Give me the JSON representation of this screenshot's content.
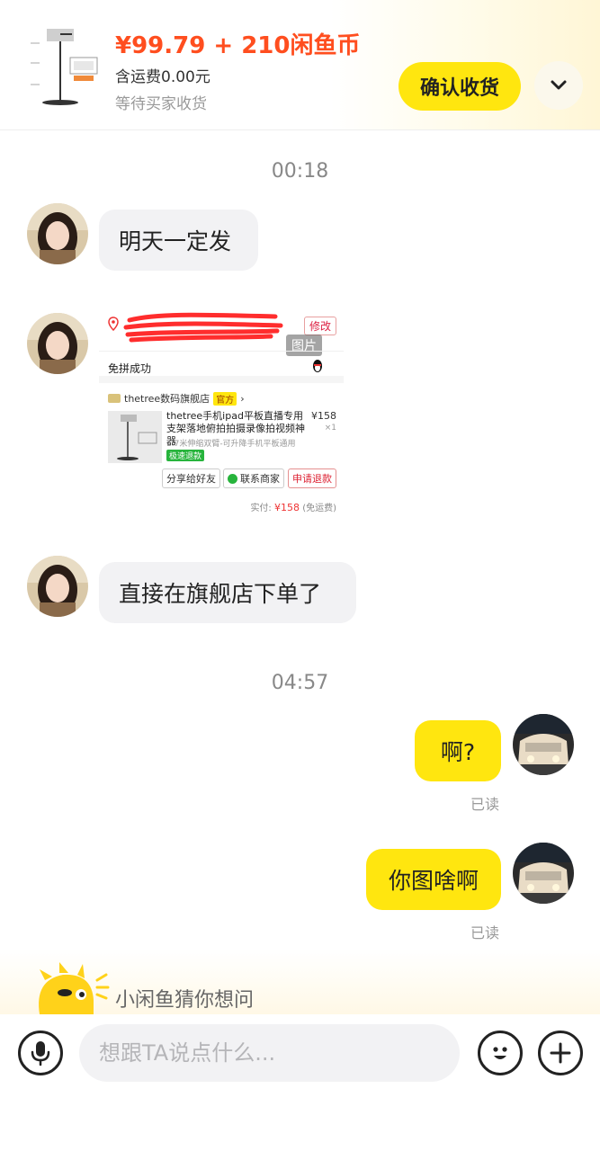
{
  "order": {
    "price": "¥99.79 + 210闲鱼币",
    "shipping": "含运费0.00元",
    "status": "等待买家收货",
    "confirm_label": "确认收货",
    "expand_icon": "chevron-down-icon"
  },
  "chat": {
    "time1": "00:18",
    "msg1": "明天一定发",
    "image_tag": "图片",
    "msg2": "直接在旗舰店下单了",
    "time2": "04:57",
    "msg3": "啊?",
    "read3": "已读",
    "msg4": "你图啥啊",
    "read4": "已读"
  },
  "screenshot": {
    "modify": "修改",
    "group_success": "免拼成功",
    "shop_name": "thetree数码旗舰店",
    "official": "官方",
    "product_title": "thetree手机ipad平板直播专用支架落地俯拍拍摄录像拍视频神器",
    "product_spec": "1.7米伸缩双臂-可升降手机平板通用",
    "fast_refund": "极速退款",
    "price": "¥158",
    "qty": "×1",
    "btn_share": "分享给好友",
    "btn_contact": "联系商家",
    "btn_refund": "申请退款",
    "paid_label": "实付:",
    "paid_value": "¥158",
    "paid_note": "(免运费)"
  },
  "suggest": {
    "text": "小闲鱼猜你想问"
  },
  "input": {
    "placeholder": "想跟TA说点什么...",
    "voice_icon": "microphone-icon",
    "emoji_icon": "emoji-icon",
    "plus_icon": "plus-icon"
  },
  "colors": {
    "accent_yellow": "#ffe60f",
    "price_orange": "#ff4e1f"
  }
}
